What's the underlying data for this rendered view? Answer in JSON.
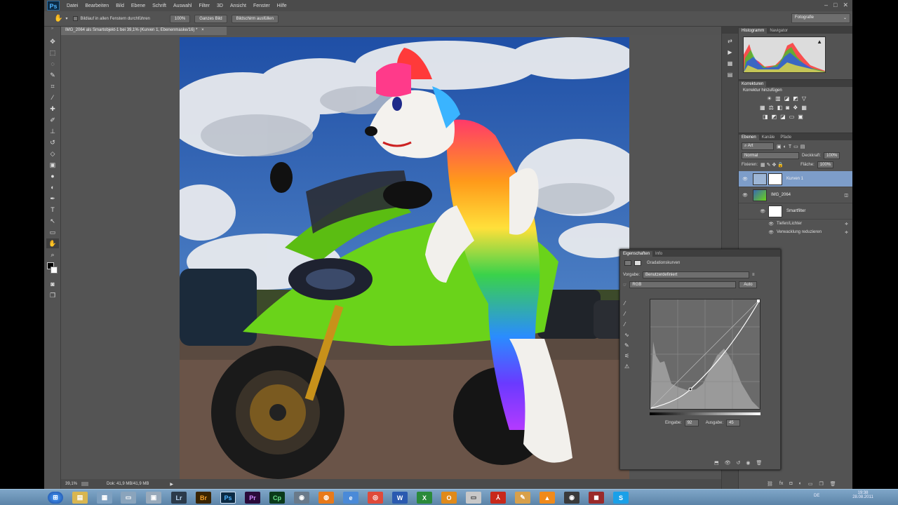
{
  "app": {
    "logo": "Ps",
    "menu": [
      "Datei",
      "Bearbeiten",
      "Bild",
      "Ebene",
      "Schrift",
      "Auswahl",
      "Filter",
      "3D",
      "Ansicht",
      "Fenster",
      "Hilfe"
    ],
    "window_buttons": [
      "–",
      "□",
      "✕"
    ]
  },
  "options_bar": {
    "scroll_all_label": "Bildlauf in allen Fenstern durchführen",
    "zoom_100": "100%",
    "fit_screen": "Ganzes Bild",
    "fill_screen": "Bildschirm ausfüllen",
    "workspace": "Fotografie"
  },
  "document": {
    "tab_title": "IMG_2064 als Smartobjekt-1 bei 39,1% (Kurven 1, Ebenenmaske/16) *",
    "tab_close": "×"
  },
  "status": {
    "zoom": "39,1%",
    "doc_size": "Dok: 41,9 MB/41,9 MB"
  },
  "histogram_panel": {
    "tabs": [
      "Histogramm",
      "Navigator"
    ]
  },
  "corrections_panel": {
    "tab": "Korrekturen",
    "subtitle": "Korrektur hinzufügen"
  },
  "layers_panel": {
    "tabs": [
      "Ebenen",
      "Kanäle",
      "Pfade"
    ],
    "filter": "Art",
    "blend_mode": "Normal",
    "opacity_label": "Deckkraft:",
    "opacity": "100%",
    "lock_label": "Fixieren:",
    "fill_label": "Fläche:",
    "fill": "100%",
    "layers": [
      {
        "name": "Kurven 1",
        "selected": true
      },
      {
        "name": "IMG_2064",
        "selected": false
      },
      {
        "name": "Smartfilter",
        "selected": false
      },
      {
        "name": "Tiefen/Lichter",
        "selected": false
      },
      {
        "name": "Verwacklung reduzieren",
        "selected": false
      }
    ]
  },
  "properties_panel": {
    "tabs": [
      "Eigenschaften",
      "Info"
    ],
    "title": "Gradationskurven",
    "preset_label": "Vorgabe:",
    "preset_value": "Benutzerdefiniert",
    "channel": "RGB",
    "auto_button": "Auto",
    "input_label": "Eingabe:",
    "input_value": "92",
    "output_label": "Ausgabe:",
    "output_value": "45"
  },
  "taskbar": {
    "apps": [
      "Lr",
      "Br",
      "Ps",
      "Pr",
      "Cp",
      "W",
      "X",
      "O"
    ],
    "tray_lang": "DE",
    "clock_time": "19:38",
    "clock_date": "28.08.2011"
  },
  "colors": {
    "ui_bg": "#535353",
    "accent_selected_layer": "#7d9dc9",
    "bike_green": "#6ad31a"
  }
}
